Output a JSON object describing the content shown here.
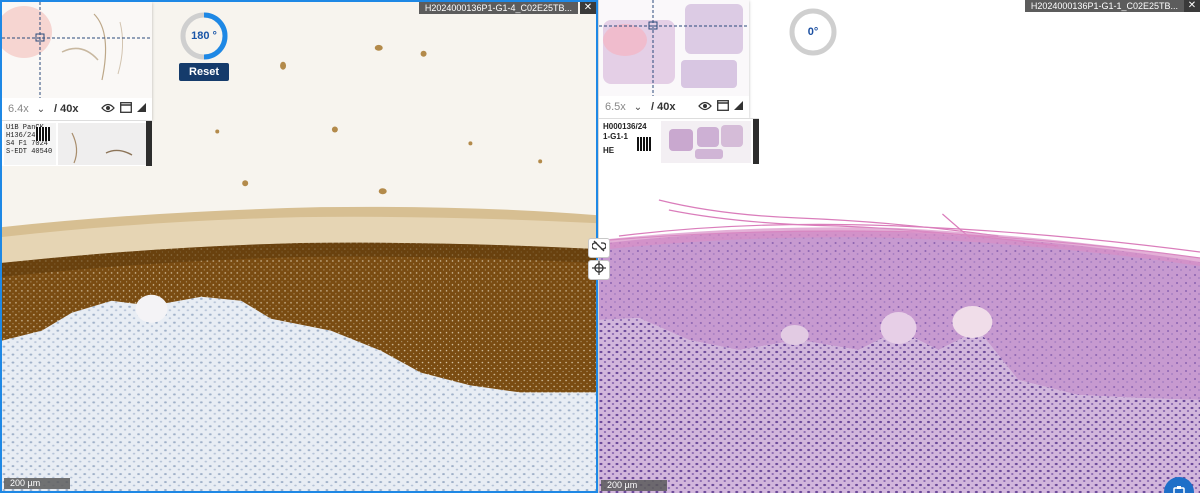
{
  "left_viewer": {
    "title": "H2024000136P1-G1-4_C02E25TB...",
    "close_label": "✕",
    "zoom_current": "6.4x",
    "zoom_max": "/ 40x",
    "rotation": "180 °",
    "reset_label": "Reset",
    "scale_label": "200 µm",
    "slide_label_lines": [
      "U1B  PanCK",
      "H136/24",
      "S4  F1  7024",
      "S-EDT  40540"
    ]
  },
  "right_viewer": {
    "title": "H2024000136P1-G1-1_C02E25TB...",
    "close_label": "✕",
    "zoom_current": "6.5x",
    "zoom_max": "/ 40x",
    "rotation": "0°",
    "scale_label": "200 µm",
    "slide_label_lines": [
      "H000136/24",
      "1-G1-1",
      "HE"
    ]
  },
  "icons": {
    "zoom_dropdown": "chevron-down-icon",
    "visibility": "eye-icon",
    "window": "window-icon",
    "resize": "corner-resize-icon",
    "unlink": "unlink-icon",
    "crosshair": "crosshair-icon",
    "fab": "clipboard-icon"
  },
  "colors": {
    "accent": "#1e88e5",
    "reset_button": "#153b6b",
    "dab_stain": "#8a5a1e",
    "he_stain": "#9a6ab8"
  }
}
